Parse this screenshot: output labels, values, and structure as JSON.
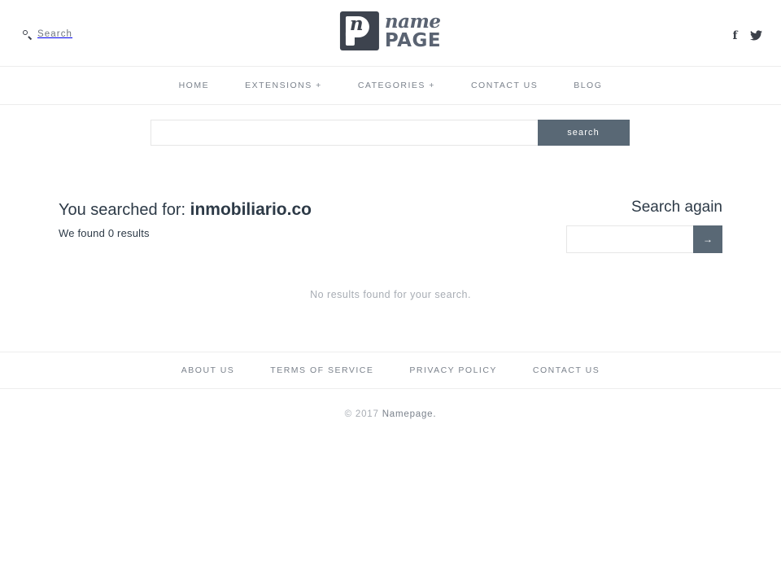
{
  "header": {
    "search_link_label": "Search",
    "search_icon": "search-icon",
    "logo": {
      "mark_letter": "n",
      "name": "name",
      "page": "PAGE"
    },
    "social": [
      {
        "name": "facebook-icon",
        "glyph": "f"
      },
      {
        "name": "twitter-icon",
        "glyph": "twitter-bird"
      }
    ]
  },
  "nav": {
    "items": [
      {
        "label": "HOME"
      },
      {
        "label": "EXTENSIONS +"
      },
      {
        "label": "CATEGORIES +"
      },
      {
        "label": "CONTACT US"
      },
      {
        "label": "BLOG"
      }
    ]
  },
  "search_bar": {
    "value": "",
    "placeholder": "",
    "button_label": "search"
  },
  "results": {
    "searched_prefix": "You searched for:",
    "search_term": "inmobiliario.co",
    "found_text": "We found 0 results",
    "empty_message": "No results found for your search."
  },
  "search_again": {
    "title": "Search again",
    "value": "",
    "placeholder": "",
    "submit_glyph": "→"
  },
  "footer": {
    "links": [
      {
        "label": "ABOUT US"
      },
      {
        "label": "TERMS OF SERVICE"
      },
      {
        "label": "PRIVACY POLICY"
      },
      {
        "label": "CONTACT US"
      }
    ],
    "copyright_prefix": "© 2017",
    "copyright_brand": "Namepage."
  },
  "colors": {
    "accent": "#596875",
    "heading": "#2d3a47",
    "muted": "#a8adb4",
    "nav_text": "#7b828c",
    "border": "#ededed",
    "logo_dark": "#3d434e",
    "logo_text": "#5a6372"
  }
}
